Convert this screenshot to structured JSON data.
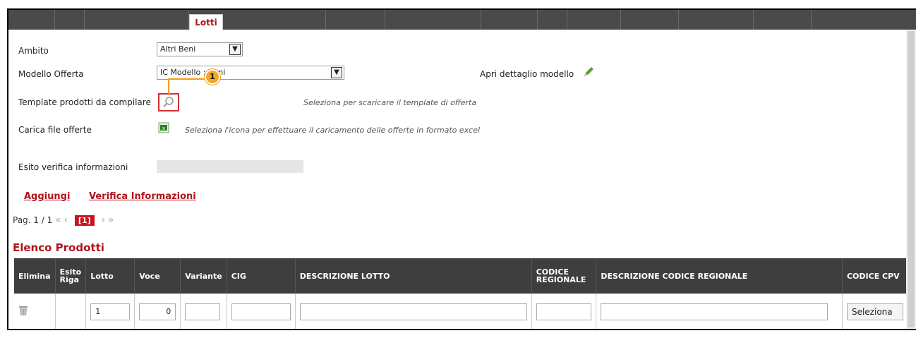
{
  "tabs": {
    "active_label": "Lotti"
  },
  "form": {
    "ambito_label": "Ambito",
    "ambito_value": "Altri Beni",
    "modello_label": "Modello Offerta",
    "modello_value": "IC Modello :   Beni",
    "apri_dettaglio": "Apri dettaglio modello",
    "template_label": "Template prodotti da compilare",
    "template_hint": "Seleziona per scaricare il template di offerta",
    "carica_label": "Carica file offerte",
    "carica_hint": "Seleziona l'icona per effettuare il caricamento delle offerte in formato excel",
    "esito_label": "Esito verifica informazioni"
  },
  "annotation": {
    "badge": "1"
  },
  "actions": {
    "aggiungi": "Aggiungi",
    "verifica": "Verifica Informazioni"
  },
  "pager": {
    "label": "Pag. 1 / 1",
    "first": "«",
    "prev": "‹",
    "current": "[1]",
    "next": "›",
    "last": "»"
  },
  "section_title": "Elenco Prodotti",
  "table": {
    "headers": {
      "elimina": "Elimina",
      "esito_1": "Esito",
      "esito_2": "Riga",
      "lotto": "Lotto",
      "voce": "Voce",
      "variante": "Variante",
      "cig": "CIG",
      "descrizione_lotto": "DESCRIZIONE LOTTO",
      "codice_reg_1": "CODICE",
      "codice_reg_2": "REGIONALE",
      "descrizione_codice": "DESCRIZIONE CODICE REGIONALE",
      "codice_cpv": "CODICE CPV"
    },
    "row": {
      "lotto": "1",
      "voce": "0",
      "cpv": "Seleziona"
    }
  },
  "colors": {
    "accent": "#b0141c",
    "header_bg": "#3e3e3e",
    "annotation": "#f29b1d"
  },
  "icons": [
    "search-icon",
    "pencil-icon",
    "excel-icon",
    "trash-icon",
    "chevron-down-icon"
  ]
}
